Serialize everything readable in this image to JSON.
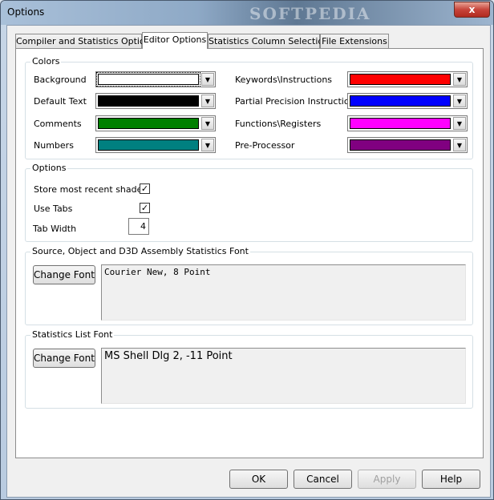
{
  "window": {
    "title": "Options",
    "watermark": "SOFTPEDIA",
    "close_label": "x"
  },
  "tabs": [
    {
      "label": "Compiler and Statistics Options"
    },
    {
      "label": "Editor Options"
    },
    {
      "label": "Statistics Column Selection"
    },
    {
      "label": "File Extensions"
    }
  ],
  "colors_group": {
    "label": "Colors",
    "items": [
      {
        "label": "Background",
        "color": "#ffffff"
      },
      {
        "label": "Default Text",
        "color": "#000000"
      },
      {
        "label": "Comments",
        "color": "#008000"
      },
      {
        "label": "Numbers",
        "color": "#008080"
      },
      {
        "label": "Keywords\\Instructions",
        "color": "#ff0000"
      },
      {
        "label": "Partial Precision Instructions",
        "color": "#0000ff"
      },
      {
        "label": "Functions\\Registers",
        "color": "#ff00ff"
      },
      {
        "label": "Pre-Processor",
        "color": "#800080"
      }
    ]
  },
  "options_group": {
    "label": "Options",
    "store_recent_label": "Store most recent shader",
    "store_recent_checked": true,
    "use_tabs_label": "Use Tabs",
    "use_tabs_checked": true,
    "tab_width_label": "Tab Width",
    "tab_width_value": "4"
  },
  "source_font_group": {
    "label": "Source, Object and D3D Assembly Statistics Font",
    "button_label": "Change Font",
    "preview": "Courier New, 8 Point"
  },
  "list_font_group": {
    "label": "Statistics List Font",
    "button_label": "Change Font",
    "preview": "MS Shell Dlg 2, -11 Point"
  },
  "buttons": {
    "ok": "OK",
    "cancel": "Cancel",
    "apply": "Apply",
    "help": "Help"
  },
  "check_glyph": "✓",
  "arrow_glyph": "▼"
}
